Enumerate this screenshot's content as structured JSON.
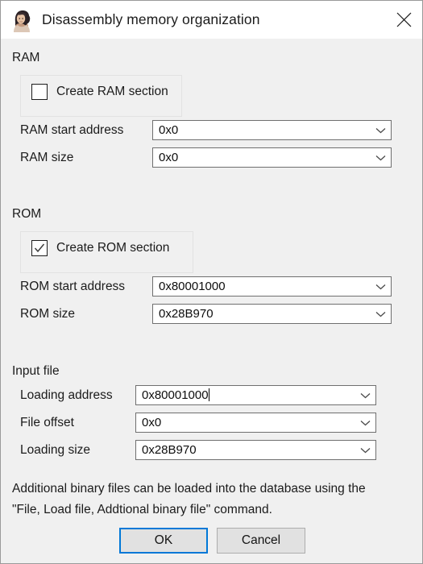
{
  "window": {
    "title": "Disassembly memory organization",
    "icon": "ida-lovelace-logo-icon",
    "close_label": "close-icon"
  },
  "ram": {
    "section_title": "RAM",
    "checkbox": {
      "label": "Create RAM section",
      "checked": false
    },
    "fields": [
      {
        "label": "RAM start address",
        "value": "0x0"
      },
      {
        "label": "RAM size",
        "value": "0x0"
      }
    ]
  },
  "rom": {
    "section_title": "ROM",
    "checkbox": {
      "label": "Create ROM section",
      "checked": true
    },
    "fields": [
      {
        "label": "ROM start address",
        "value": "0x80001000"
      },
      {
        "label": "ROM size",
        "value": "0x28B970"
      }
    ]
  },
  "input_file": {
    "section_title": "Input file",
    "fields": [
      {
        "label": "Loading address",
        "value": "0x80001000",
        "focused": true
      },
      {
        "label": "File offset",
        "value": "0x0",
        "focused": false
      },
      {
        "label": "Loading size",
        "value": "0x28B970",
        "focused": false
      }
    ]
  },
  "note": {
    "line1": "Additional binary files can be loaded into the database using the",
    "line2": "\"File, Load file, Addtional binary file\" command."
  },
  "buttons": {
    "ok": "OK",
    "cancel": "Cancel"
  },
  "colors": {
    "dialog_background": "#f0f0f0",
    "titlebar_background": "#ffffff",
    "focus_accent": "#0078d7",
    "field_border": "#6f6f6f",
    "button_face": "#e1e1e1",
    "text": "#1b1b1b"
  }
}
